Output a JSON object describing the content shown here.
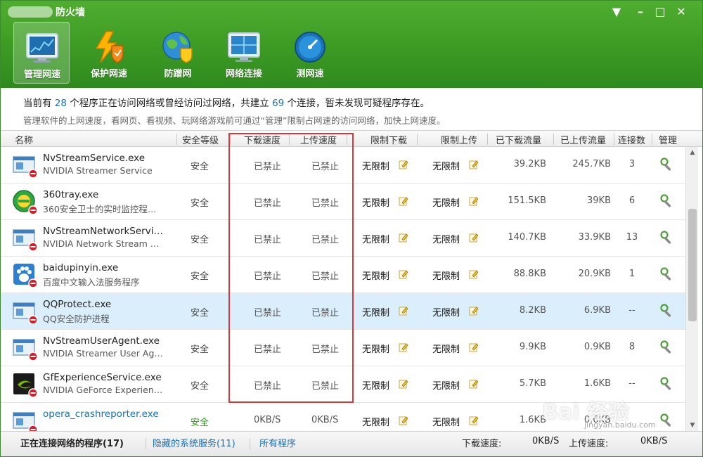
{
  "window": {
    "title": "防火墙",
    "controls": [
      "▼",
      "–",
      "□",
      "✕"
    ]
  },
  "toolbar": [
    {
      "label": "管理网速",
      "icon": "monitor-chart-icon",
      "active": true
    },
    {
      "label": "保护网速",
      "icon": "lightning-shield-icon",
      "active": false
    },
    {
      "label": "防蹭网",
      "icon": "globe-shield-icon",
      "active": false
    },
    {
      "label": "网络连接",
      "icon": "network-monitor-icon",
      "active": false
    },
    {
      "label": "测网速",
      "icon": "speedometer-icon",
      "active": false
    }
  ],
  "info": {
    "p1": "当前有 ",
    "programs": "28",
    "p2": " 个程序正在访问网络或曾经访问过网络，共建立 ",
    "connections": "69",
    "p3": " 个连接，暂未发现可疑程序存在。",
    "line2": "管理软件的上网速度，看网页、看视频、玩网络游戏前可通过“管理”限制占网速的访问网络，加快上网速度。"
  },
  "columns": {
    "name": "名称",
    "safety": "安全等级",
    "download_speed": "下载速度",
    "upload_speed": "上传速度",
    "limit_download": "限制下载",
    "limit_upload": "限制上传",
    "downloaded": "已下载流量",
    "uploaded": "已上传流量",
    "conn_count": "连接数",
    "manage": "管理"
  },
  "rows": [
    {
      "name": "NvStreamService.exe",
      "desc": "NVIDIA Streamer Service",
      "safety": "安全",
      "dl": "已禁止",
      "ul": "已禁止",
      "lim_dl": "无限制",
      "lim_ul": "无限制",
      "dl_total": "39.2KB",
      "ul_total": "245.7KB",
      "conn": "3",
      "icon": "window-app-icon"
    },
    {
      "name": "360tray.exe",
      "desc": "360安全卫士的实时监控程…",
      "safety": "安全",
      "dl": "已禁止",
      "ul": "已禁止",
      "lim_dl": "无限制",
      "lim_ul": "无限制",
      "dl_total": "151.5KB",
      "ul_total": "39KB",
      "conn": "6",
      "icon": "360-icon"
    },
    {
      "name": "NvStreamNetworkServi…",
      "desc": "NVIDIA Network Stream …",
      "safety": "安全",
      "dl": "已禁止",
      "ul": "已禁止",
      "lim_dl": "无限制",
      "lim_ul": "无限制",
      "dl_total": "140.7KB",
      "ul_total": "33.9KB",
      "conn": "13",
      "icon": "window-app-icon"
    },
    {
      "name": "baidupinyin.exe",
      "desc": "百度中文输入法服务程序",
      "safety": "安全",
      "dl": "已禁止",
      "ul": "已禁止",
      "lim_dl": "无限制",
      "lim_ul": "无限制",
      "dl_total": "88.8KB",
      "ul_total": "20.9KB",
      "conn": "1",
      "icon": "paw-icon"
    },
    {
      "name": "QQProtect.exe",
      "desc": "QQ安全防护进程",
      "safety": "安全",
      "dl": "已禁止",
      "ul": "已禁止",
      "lim_dl": "无限制",
      "lim_ul": "无限制",
      "dl_total": "8.2KB",
      "ul_total": "6.9KB",
      "conn": "--",
      "icon": "window-app-icon",
      "selected": true
    },
    {
      "name": "NvStreamUserAgent.exe",
      "desc": "NVIDIA Streamer User Ag…",
      "safety": "安全",
      "dl": "已禁止",
      "ul": "已禁止",
      "lim_dl": "无限制",
      "lim_ul": "无限制",
      "dl_total": "9.9KB",
      "ul_total": "0.9KB",
      "conn": "8",
      "icon": "window-app-icon"
    },
    {
      "name": "GfExperienceService.exe",
      "desc": "NVIDIA GeForce Experien…",
      "safety": "安全",
      "dl": "已禁止",
      "ul": "已禁止",
      "lim_dl": "无限制",
      "lim_ul": "无限制",
      "dl_total": "5.7KB",
      "ul_total": "1.6KB",
      "conn": "--",
      "icon": "nvidia-icon"
    },
    {
      "name": "opera_crashreporter.exe",
      "desc": "",
      "safety": "安全",
      "dl": "0KB/S",
      "ul": "0KB/S",
      "lim_dl": "无限制",
      "lim_ul": "无限制",
      "dl_total": "1.6KB",
      "ul_total": "0.6KB",
      "conn": "",
      "icon": "window-app-icon",
      "highlight_name": true
    }
  ],
  "footer": {
    "tab_active": "正在连接网络的程序(17)",
    "tab_hidden": "隐藏的系统服务(11)",
    "tab_all": "所有程序",
    "dl_label": "下载速度:",
    "dl_value": "0KB/S",
    "ul_label": "上传速度:",
    "ul_value": "0KB/S"
  },
  "watermark": {
    "text": "Bai 经验",
    "sub": "jingyan.baidu.com"
  },
  "colors": {
    "header_green": "#3c9a24",
    "link_blue": "#1a6fb5",
    "highlight_red": "#d9383a",
    "selected_row": "#dbeefb"
  }
}
